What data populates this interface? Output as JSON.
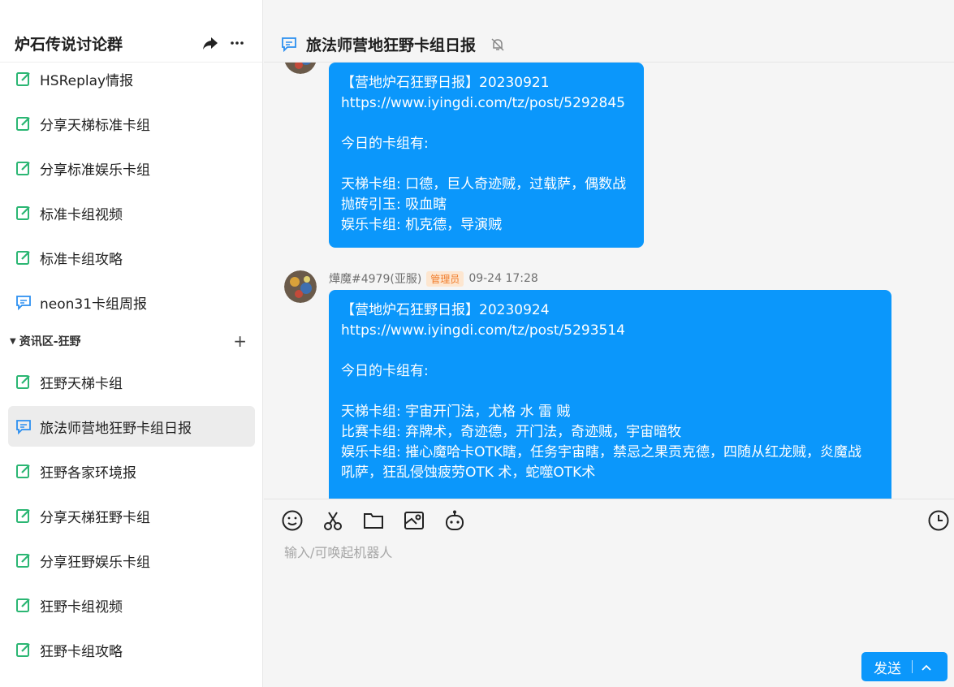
{
  "sidebar": {
    "title": "炉石传说讨论群",
    "channels_top": [
      {
        "label": "HSReplay情报",
        "icon": "note-edit-icon"
      },
      {
        "label": "分享天梯标准卡组",
        "icon": "note-edit-icon"
      },
      {
        "label": "分享标准娱乐卡组",
        "icon": "note-edit-icon"
      },
      {
        "label": "标准卡组视频",
        "icon": "note-edit-icon"
      },
      {
        "label": "标准卡组攻略",
        "icon": "note-edit-icon"
      },
      {
        "label": "neon31卡组周报",
        "icon": "chat-icon"
      }
    ],
    "section": {
      "label": "资讯区-狂野",
      "add": "+"
    },
    "channels_wild": [
      {
        "label": "狂野天梯卡组",
        "icon": "note-edit-icon"
      },
      {
        "label": "旅法师营地狂野卡组日报",
        "icon": "chat-icon",
        "active": true
      },
      {
        "label": "狂野各家环境报",
        "icon": "note-edit-icon"
      },
      {
        "label": "分享天梯狂野卡组",
        "icon": "note-edit-icon"
      },
      {
        "label": "分享狂野娱乐卡组",
        "icon": "note-edit-icon"
      },
      {
        "label": "狂野卡组视频",
        "icon": "note-edit-icon"
      },
      {
        "label": "狂野卡组攻略",
        "icon": "note-edit-icon"
      }
    ]
  },
  "header": {
    "title": "旅法师营地狂野卡组日报"
  },
  "messages": [
    {
      "text": "【营地炉石狂野日报】20230921\nhttps://www.iyingdi.com/tz/post/5292845\n\n今日的卡组有:\n\n天梯卡组: 口德，巨人奇迹贼，过载萨，偶数战\n抛砖引玉: 吸血瞎\n娱乐卡组: 机克德，导演贼"
    },
    {
      "author": "燁魔#4979(亚服)",
      "role": "管理员",
      "time": "09-24 17:28",
      "text": "【营地炉石狂野日报】20230924\nhttps://www.iyingdi.com/tz/post/5293514\n\n今日的卡组有:\n\n天梯卡组: 宇宙开门法，尤格 水 雷 贼\n比赛卡组: 弃牌术，奇迹德，开门法，奇迹贼，宇宙暗牧\n娱乐卡组: 摧心魔哈卡OTK瞎，任务宇宙瞎，禁忌之果贡克德，四随从红龙贼，炎魔战\n吼萨，狂乱侵蚀疲劳OTK 术，蛇噬OTK术"
    }
  ],
  "composer": {
    "placeholder": "输入/可唤起机器人",
    "send_label": "发送"
  },
  "colors": {
    "accent": "#0b97fb",
    "note_icon": "#2bb673",
    "chat_icon": "#2b8ff0",
    "badge_text": "#f07c2a"
  }
}
